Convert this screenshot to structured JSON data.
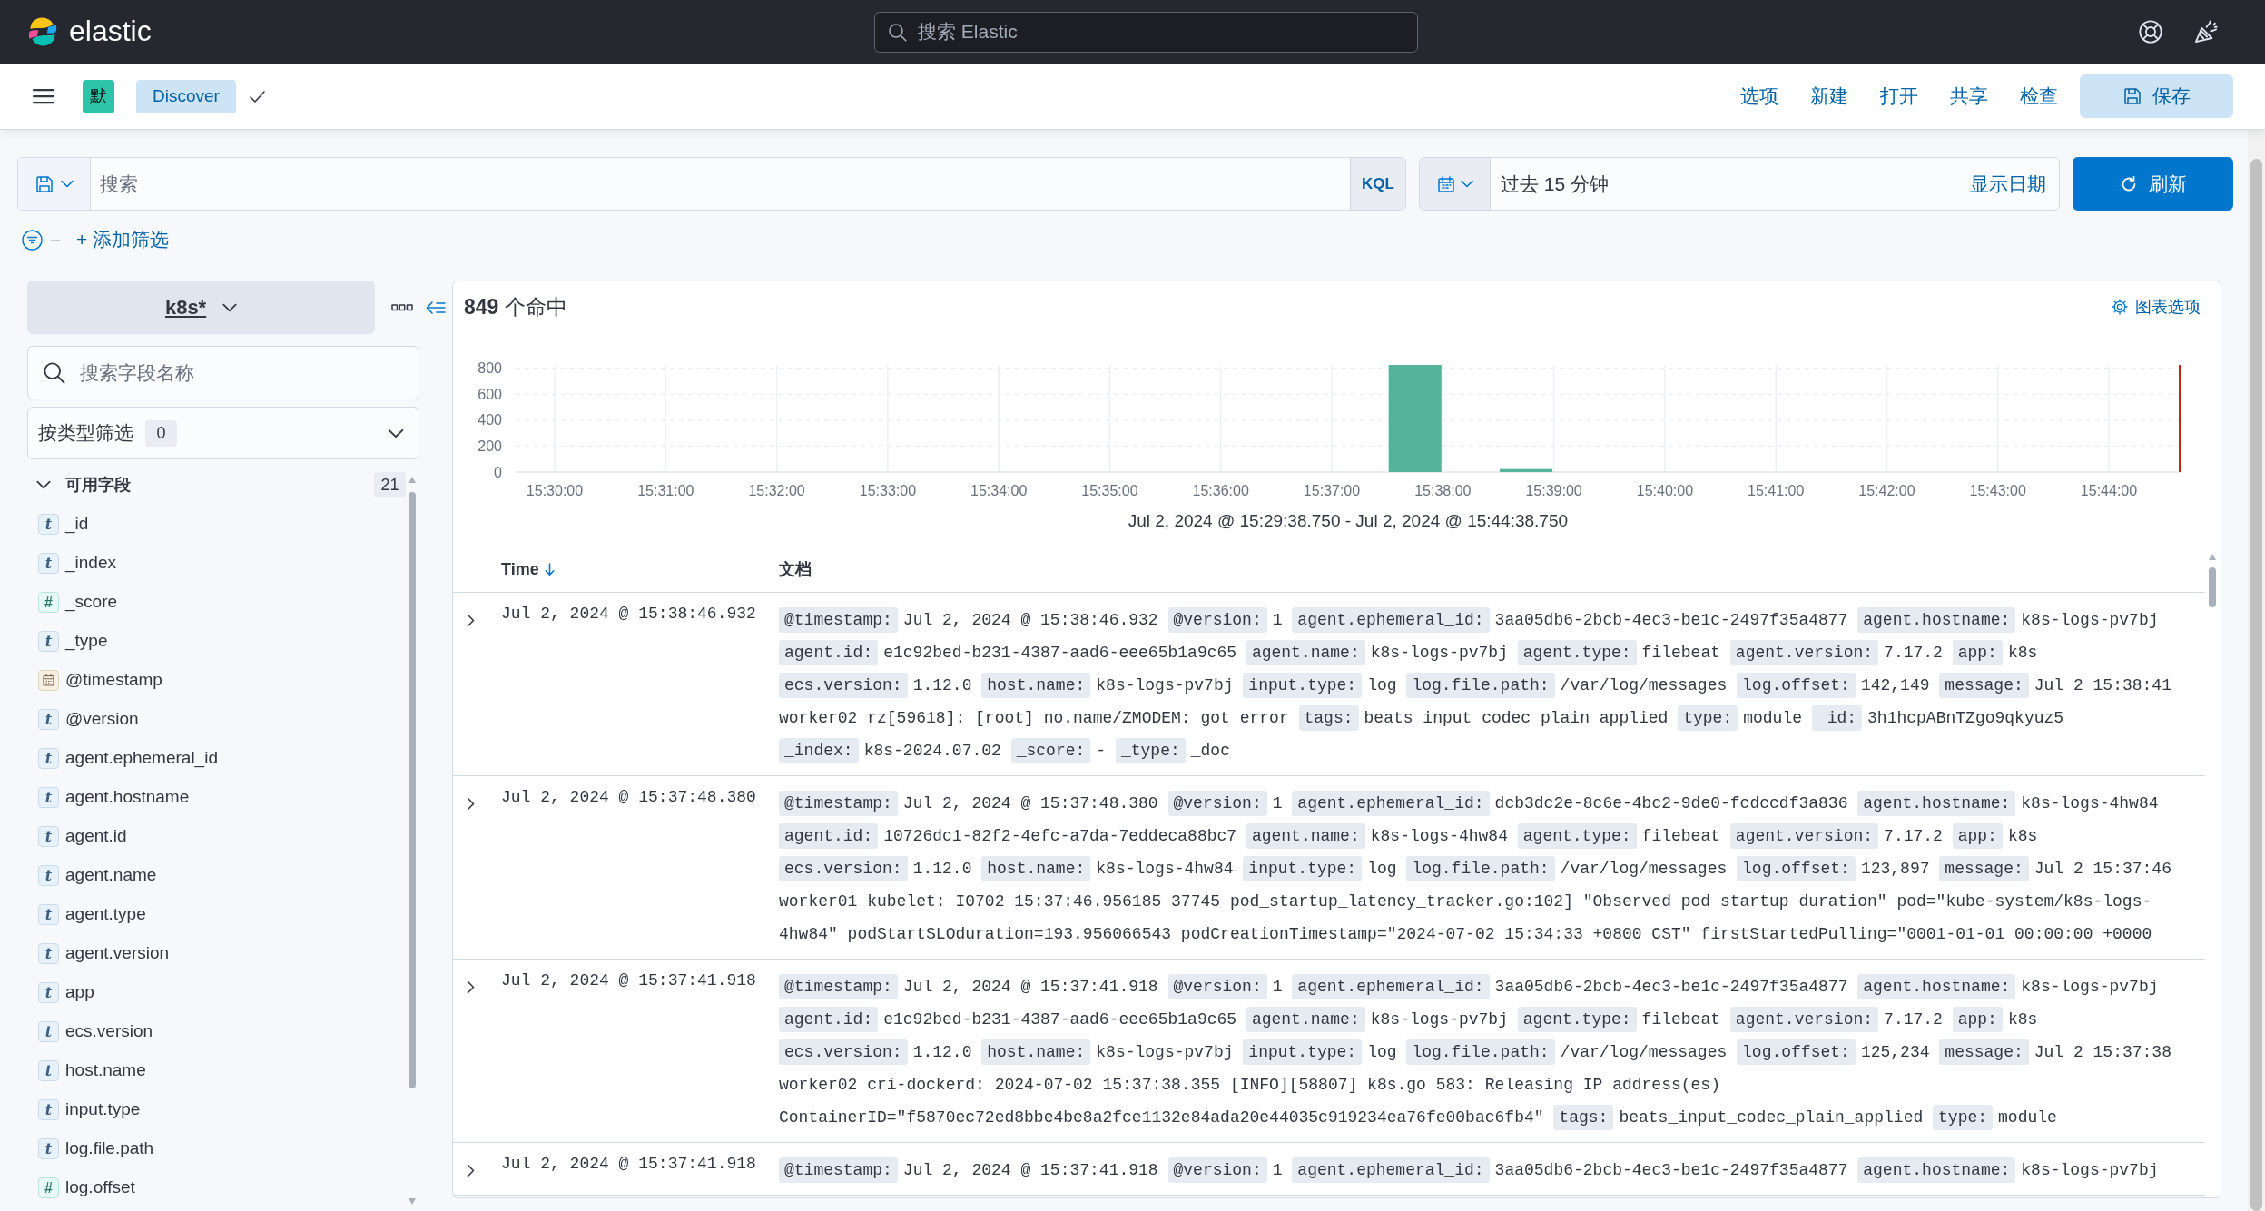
{
  "top_header": {
    "logo_text": "elastic",
    "search_placeholder": "搜索 Elastic"
  },
  "app_bar": {
    "space_initial": "默",
    "breadcrumb": "Discover",
    "menu": [
      "选项",
      "新建",
      "打开",
      "共享",
      "检查"
    ],
    "save_button": "保存"
  },
  "query_bar": {
    "placeholder": "搜索",
    "language_button": "KQL",
    "date_range": "过去 15 分钟",
    "show_dates": "显示日期",
    "refresh_button": "刷新",
    "add_filter": "+ 添加筛选"
  },
  "sidebar": {
    "index_pattern": "k8s*",
    "field_search_placeholder": "搜索字段名称",
    "type_filter": {
      "label": "按类型筛选",
      "count": "0"
    },
    "available_fields": {
      "title": "可用字段",
      "count": "21",
      "expanded": true,
      "fields": [
        {
          "name": "_id",
          "kind": "string",
          "token": "t"
        },
        {
          "name": "_index",
          "kind": "string",
          "token": "t"
        },
        {
          "name": "_score",
          "kind": "number",
          "token": "#"
        },
        {
          "name": "_type",
          "kind": "string",
          "token": "t"
        },
        {
          "name": "@timestamp",
          "kind": "date"
        },
        {
          "name": "@version",
          "kind": "string",
          "token": "t"
        },
        {
          "name": "agent.ephemeral_id",
          "kind": "string",
          "token": "t"
        },
        {
          "name": "agent.hostname",
          "kind": "string",
          "token": "t"
        },
        {
          "name": "agent.id",
          "kind": "string",
          "token": "t"
        },
        {
          "name": "agent.name",
          "kind": "string",
          "token": "t"
        },
        {
          "name": "agent.type",
          "kind": "string",
          "token": "t"
        },
        {
          "name": "agent.version",
          "kind": "string",
          "token": "t"
        },
        {
          "name": "app",
          "kind": "string",
          "token": "t"
        },
        {
          "name": "ecs.version",
          "kind": "string",
          "token": "t"
        },
        {
          "name": "host.name",
          "kind": "string",
          "token": "t"
        },
        {
          "name": "input.type",
          "kind": "string",
          "token": "t"
        },
        {
          "name": "log.file.path",
          "kind": "string",
          "token": "t"
        },
        {
          "name": "log.offset",
          "kind": "number",
          "token": "#"
        }
      ]
    }
  },
  "results": {
    "hits": "**849** 个命中",
    "chart_options": "图表选项",
    "chart_data": {
      "type": "bar",
      "xlabel": "Jul 2, 2024 @ 15:29:38.750 - Jul 2, 2024 @ 15:44:38.750",
      "categories": [
        null,
        "15:30:00",
        null,
        "15:31:00",
        null,
        "15:32:00",
        null,
        "15:33:00",
        null,
        "15:34:00",
        null,
        "15:35:00",
        null,
        "15:36:00",
        null,
        "15:37:00",
        null,
        "15:38:00",
        null,
        "15:39:00",
        null,
        "15:40:00",
        null,
        "15:41:00",
        null,
        "15:42:00",
        null,
        "15:43:00",
        null,
        "15:44:00",
        null
      ],
      "values": [
        0,
        0,
        0,
        0,
        0,
        0,
        0,
        0,
        0,
        0,
        0,
        0,
        0,
        0,
        0,
        0,
        826,
        0,
        23,
        0,
        0,
        0,
        0,
        0,
        0,
        0,
        0,
        0,
        0,
        0,
        0
      ],
      "ylim": [
        0,
        826
      ],
      "yticks": [
        0,
        200,
        400,
        600,
        800
      ],
      "grid": true
    },
    "table": {
      "columns": [
        {
          "label": "Time",
          "sort_descending": true
        },
        {
          "label": "文档"
        }
      ],
      "rows": [
        {
          "time": "Jul 2, 2024 @ 15:38:46.932",
          "expanded": false,
          "fields": [
            {
              "key": "@timestamp:",
              "value": "Jul 2, 2024 @ 15:38:46.932"
            },
            {
              "key": "@version:",
              "value": "1"
            },
            {
              "key": "agent.ephemeral_id:",
              "value": "3aa05db6-2bcb-4ec3-be1c-2497f35a4877"
            },
            {
              "key": "agent.hostname:",
              "value": "k8s-logs-pv7bj"
            },
            {
              "key": "agent.id:",
              "value": "e1c92bed-b231-4387-aad6-eee65b1a9c65"
            },
            {
              "key": "agent.name:",
              "value": "k8s-logs-pv7bj"
            },
            {
              "key": "agent.type:",
              "value": "filebeat"
            },
            {
              "key": "agent.version:",
              "value": "7.17.2"
            },
            {
              "key": "app:",
              "value": "k8s"
            },
            {
              "key": "ecs.version:",
              "value": "1.12.0"
            },
            {
              "key": "host.name:",
              "value": "k8s-logs-pv7bj"
            },
            {
              "key": "input.type:",
              "value": "log"
            },
            {
              "key": "log.file.path:",
              "value": "/var/log/messages"
            },
            {
              "key": "log.offset:",
              "value": "142,149"
            },
            {
              "key": "message:",
              "value": "Jul 2 15:38:41 worker02 rz[59618]: [root] no.name/ZMODEM: got error"
            },
            {
              "key": "tags:",
              "value": "beats_input_codec_plain_applied"
            },
            {
              "key": "type:",
              "value": "module"
            },
            {
              "key": "_id:",
              "value": "3h1hcpABnTZgo9qkyuz5"
            },
            {
              "key": "_index:",
              "value": "k8s-2024.07.02"
            },
            {
              "key": "_score:",
              "value": "-"
            },
            {
              "key": "_type:",
              "value": "_doc"
            }
          ]
        },
        {
          "time": "Jul 2, 2024 @ 15:37:48.380",
          "expanded": false,
          "fields": [
            {
              "key": "@timestamp:",
              "value": "Jul 2, 2024 @ 15:37:48.380"
            },
            {
              "key": "@version:",
              "value": "1"
            },
            {
              "key": "agent.ephemeral_id:",
              "value": "dcb3dc2e-8c6e-4bc2-9de0-fcdccdf3a836"
            },
            {
              "key": "agent.hostname:",
              "value": "k8s-logs-4hw84"
            },
            {
              "key": "agent.id:",
              "value": "10726dc1-82f2-4efc-a7da-7eddeca88bc7"
            },
            {
              "key": "agent.name:",
              "value": "k8s-logs-4hw84"
            },
            {
              "key": "agent.type:",
              "value": "filebeat"
            },
            {
              "key": "agent.version:",
              "value": "7.17.2"
            },
            {
              "key": "app:",
              "value": "k8s"
            },
            {
              "key": "ecs.version:",
              "value": "1.12.0"
            },
            {
              "key": "host.name:",
              "value": "k8s-logs-4hw84"
            },
            {
              "key": "input.type:",
              "value": "log"
            },
            {
              "key": "log.file.path:",
              "value": "/var/log/messages"
            },
            {
              "key": "log.offset:",
              "value": "123,897"
            },
            {
              "key": "message:",
              "value": "Jul 2 15:37:46 worker01 kubelet: I0702 15:37:46.956185 37745 pod_startup_latency_tracker.go:102] \"Observed pod startup duration\" pod=\"kube-system/k8s-logs-4hw84\" podStartSLOduration=193.956066543 podCreationTimestamp=\"2024-07-02 15:34:33 +0800 CST\" firstStartedPulling=\"0001-01-01 00:00:00 +0000"
            }
          ]
        },
        {
          "time": "Jul 2, 2024 @ 15:37:41.918",
          "expanded": false,
          "fields": [
            {
              "key": "@timestamp:",
              "value": "Jul 2, 2024 @ 15:37:41.918"
            },
            {
              "key": "@version:",
              "value": "1"
            },
            {
              "key": "agent.ephemeral_id:",
              "value": "3aa05db6-2bcb-4ec3-be1c-2497f35a4877"
            },
            {
              "key": "agent.hostname:",
              "value": "k8s-logs-pv7bj"
            },
            {
              "key": "agent.id:",
              "value": "e1c92bed-b231-4387-aad6-eee65b1a9c65"
            },
            {
              "key": "agent.name:",
              "value": "k8s-logs-pv7bj"
            },
            {
              "key": "agent.type:",
              "value": "filebeat"
            },
            {
              "key": "agent.version:",
              "value": "7.17.2"
            },
            {
              "key": "app:",
              "value": "k8s"
            },
            {
              "key": "ecs.version:",
              "value": "1.12.0"
            },
            {
              "key": "host.name:",
              "value": "k8s-logs-pv7bj"
            },
            {
              "key": "input.type:",
              "value": "log"
            },
            {
              "key": "log.file.path:",
              "value": "/var/log/messages"
            },
            {
              "key": "log.offset:",
              "value": "125,234"
            },
            {
              "key": "message:",
              "value": "Jul 2 15:37:38 worker02 cri-dockerd: 2024-07-02 15:37:38.355 [INFO][58807] k8s.go 583: Releasing IP address(es) ContainerID=\"f5870ec72ed8bbe4be8a2fce1132e84ada20e44035c919234ea76fe00bac6fb4\""
            },
            {
              "key": "tags:",
              "value": "beats_input_codec_plain_applied"
            },
            {
              "key": "type:",
              "value": "module"
            }
          ]
        },
        {
          "time": "Jul 2, 2024 @ 15:37:41.918",
          "expanded": false,
          "fields": [
            {
              "key": "@timestamp:",
              "value": "Jul 2, 2024 @ 15:37:41.918"
            },
            {
              "key": "@version:",
              "value": "1"
            },
            {
              "key": "agent.ephemeral_id:",
              "value": "3aa05db6-2bcb-4ec3-be1c-2497f35a4877"
            },
            {
              "key": "agent.hostname:",
              "value": "k8s-logs-pv7bj"
            }
          ]
        }
      ]
    }
  }
}
